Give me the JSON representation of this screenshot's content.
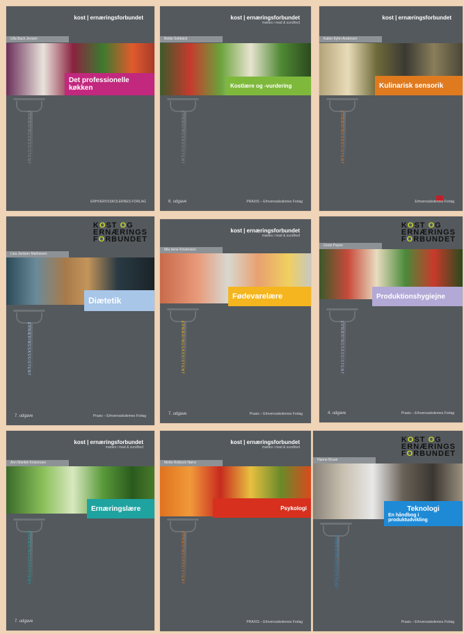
{
  "books": [
    {
      "logo": "kost | ernæringsforbundet",
      "logo_sub": "",
      "author": "Ulla Bach Jensen",
      "title": "Det professionelle køkken",
      "spine_text": "ERNÆRINGSASSISTENT",
      "edition": "",
      "publisher": "ERHVERVSSKOLERNES FORLAG",
      "accent": "#c2287e"
    },
    {
      "logo": "kost | ernæringsforbundet",
      "logo_sub": "mødes i mad & sundhed",
      "author": "Bettie Soltbäck",
      "title": "Kostlære og -vurdering",
      "spine_text": "ERNÆRINGSASSISTENT",
      "edition": "6. udgave",
      "publisher": "PRAXIS – Erhvervsskolernes Forlag",
      "accent": "#7fb93c"
    },
    {
      "logo": "kost | ernæringsforbundet",
      "logo_sub": "",
      "author": "Katrin Kyhn Andersen",
      "title": "Kulinarisk sensorik",
      "spine_text": "ERNÆRINGSASSISTENT",
      "edition": "",
      "publisher": "Erhvervsskolernes Forlag",
      "accent": "#e07a1f"
    },
    {
      "logo": "KOST OG ERNÆRINGS FORBUNDET",
      "logo_sub": "",
      "author": "Lisa Jantzen Mathiesen",
      "title": "Diætetik",
      "spine_text": "ERNÆRINGSASSISTENT",
      "edition": "7. udgave",
      "publisher": "Praxis – Erhvervsskolernes Forlag",
      "accent": "#a8c6e8"
    },
    {
      "logo": "kost | ernæringsforbundet",
      "logo_sub": "mødes i mad & sundhed",
      "author": "Mia Irene Kristensen",
      "title": "Fødevarelære",
      "spine_text": "ERNÆRINGSASSISTENT",
      "edition": "7. udgave",
      "publisher": "Praxis – Erhvervsskolernes Forlag",
      "accent": "#f4b51e"
    },
    {
      "logo": "KOST OG ERNÆRINGS FORBUNDET",
      "logo_sub": "",
      "author": "Grete Payne",
      "title": "Produktionshygiejne",
      "spine_text": "ERNÆRINGSASSISTENT",
      "edition": "4. udgave",
      "publisher": "Praxis – Erhvervsskolernes Forlag",
      "accent": "#b3a9d6"
    },
    {
      "logo": "kost | ernæringsforbundet",
      "logo_sub": "mødes i mad & sundhed",
      "author": "Ann Marikki Kristensen",
      "title": "Ernæringslære",
      "spine_text": "ERNÆRINGSASSISTENT",
      "edition": "7. udgave",
      "publisher": "",
      "accent": "#1fa3a0"
    },
    {
      "logo": "kost | ernæringsforbundet",
      "logo_sub": "mødes i mad & sundhed",
      "author": "Mette Rolbeck Nørre",
      "title": "Psykologi",
      "spine_text": "ERNÆRINGSASSISTENT",
      "edition": "",
      "publisher": "PRAXIS – Erhvervsskolernes Forlag",
      "accent": "#d7301e"
    },
    {
      "logo": "KOST OG ERNÆRINGS FORBUNDET",
      "logo_sub": "",
      "author": "Hanne Bruun",
      "title": "Teknologi",
      "subtitle": "En håndbog i produktudvikling",
      "spine_text": "ERNÆRINGSASSISTENT",
      "edition": "",
      "publisher": "Praxis – Erhvervsskolernes Forlag",
      "accent": "#1e8ad6"
    }
  ],
  "colors": {
    "background": "#f0d4b8",
    "cover": "#54595d"
  }
}
